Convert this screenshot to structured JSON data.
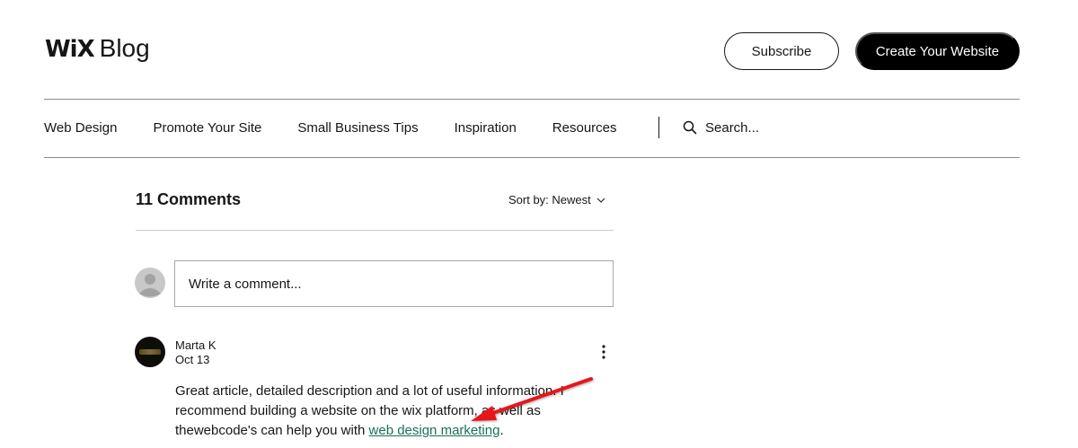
{
  "header": {
    "logo_wix": "WiX",
    "logo_blog": "Blog",
    "subscribe_label": "Subscribe",
    "create_label": "Create Your Website"
  },
  "nav": {
    "items": [
      {
        "label": "Web Design"
      },
      {
        "label": "Promote Your Site"
      },
      {
        "label": "Small Business Tips"
      },
      {
        "label": "Inspiration"
      },
      {
        "label": "Resources"
      }
    ],
    "search_placeholder": "Search..."
  },
  "comments": {
    "title": "11 Comments",
    "sort_label": "Sort by: Newest",
    "input_placeholder": "Write a comment...",
    "list": [
      {
        "author": "Marta K",
        "date": "Oct 13",
        "text_before_link": "Great article, detailed description and a lot of useful information. I recommend building a website on the wix platform, as well as thewebcode's can help you with ",
        "link_text": "web design marketing",
        "text_after_link": "."
      }
    ]
  },
  "colors": {
    "annotation_arrow": "#e8141b",
    "link": "#1a6f5a",
    "primary_button": "#000000"
  },
  "icons": {
    "search": "search-icon",
    "sort": "chevron-down-icon",
    "more": "more-vertical-icon",
    "avatar_placeholder": "user-avatar-icon"
  }
}
